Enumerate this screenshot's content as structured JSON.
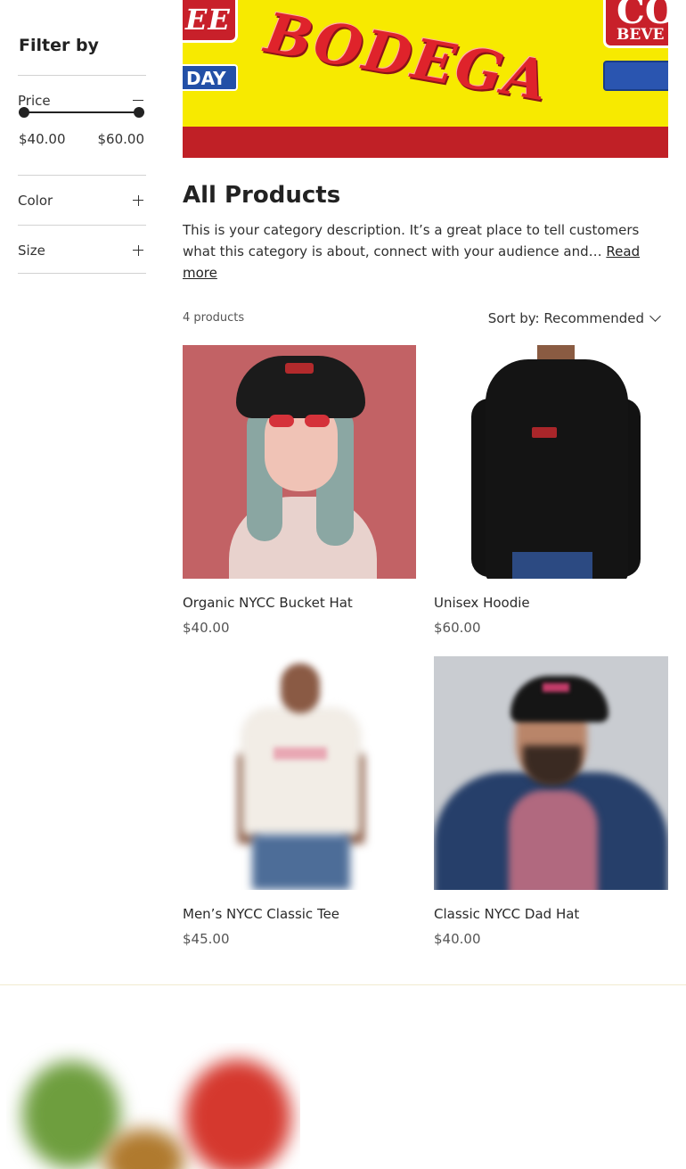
{
  "sidebar": {
    "title": "Filter by",
    "price": {
      "label": "Price",
      "min": "$40.00",
      "max": "$60.00",
      "slider_min_fraction": 0,
      "slider_max_fraction": 1
    },
    "color": {
      "label": "Color"
    },
    "size": {
      "label": "Size"
    }
  },
  "banner": {
    "store_name": "BODEGA",
    "sign_left": "EE",
    "sign_day": "DAY",
    "sign_right_big": "CO",
    "sign_right_small": "BEVE"
  },
  "category": {
    "title": "All Products",
    "description": "This is your category description. It’s a great place to tell customers what this category is about, connect with your audience and…",
    "read_more": "Read more"
  },
  "toolbar": {
    "count": "4 products",
    "sort_label": "Sort by: Recommended"
  },
  "products": [
    {
      "name": "Organic NYCC Bucket Hat",
      "price": "$40.00"
    },
    {
      "name": "Unisex Hoodie",
      "price": "$60.00"
    },
    {
      "name": "Men’s NYCC Classic Tee",
      "price": "$45.00"
    },
    {
      "name": "Classic NYCC Dad Hat",
      "price": "$40.00"
    }
  ],
  "colors": {
    "text": "#222222",
    "banner_yellow": "#f7ea00",
    "banner_red": "#c02026",
    "divider": "#d2d2d2"
  }
}
